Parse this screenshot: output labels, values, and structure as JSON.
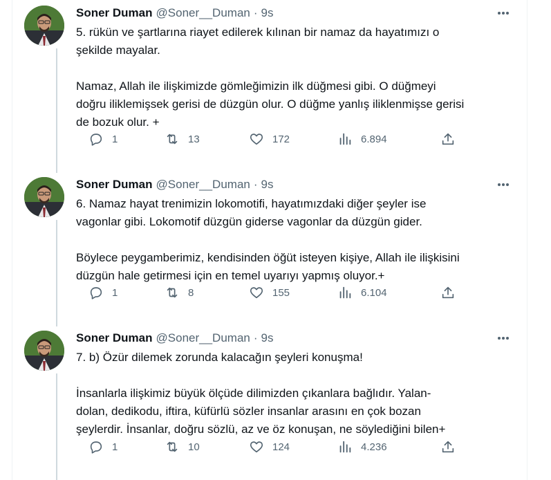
{
  "tweets": [
    {
      "name": "Soner Duman",
      "handle": "@Soner__Duman",
      "dot": "·",
      "time": "9s",
      "text": "5. rükün ve şartlarına riayet edilerek kılınan bir namaz da hayatımızı o\nşekilde mayalar.\n\nNamaz, Allah ile ilişkimizde gömleğimizin ilk düğmesi gibi. O düğmeyi\ndoğru iliklemişsek gerisi de düzgün olur. O düğme yanlış iliklenmişse gerisi\nde bozuk olur. +",
      "replies": "1",
      "retweets": "13",
      "likes": "172",
      "views": "6.894"
    },
    {
      "name": "Soner Duman",
      "handle": "@Soner__Duman",
      "dot": "·",
      "time": "9s",
      "text": "6. Namaz hayat trenimizin lokomotifi, hayatımızdaki diğer şeyler ise\nvagonlar gibi. Lokomotif düzgün giderse vagonlar da düzgün gider.\n\nBöylece peygamberimiz, kendisinden öğüt isteyen kişiye, Allah ile ilişkisini\ndüzgün hale getirmesi için en temel uyarıyı yapmış oluyor.+",
      "replies": "1",
      "retweets": "8",
      "likes": "155",
      "views": "6.104"
    },
    {
      "name": "Soner Duman",
      "handle": "@Soner__Duman",
      "dot": "·",
      "time": "9s",
      "text": "7. b) Özür dilemek zorunda kalacağın şeyleri konuşma!\n\nİnsanlarla ilişkimiz büyük ölçüde dilimizden çıkanlara bağlıdır. Yalan-\ndolan, dedikodu, iftira, küfürlü sözler insanlar arasını en çok bozan\nşeylerdir. İnsanlar, doğru sözlü, az ve öz konuşan, ne söylediğini bilen+",
      "replies": "1",
      "retweets": "10",
      "likes": "124",
      "views": "4.236"
    }
  ],
  "icons": {
    "reply": "reply-icon",
    "retweet": "retweet-icon",
    "like": "heart-icon",
    "views": "views-icon",
    "share": "share-icon",
    "more": "more-icon"
  },
  "colors": {
    "text": "#0f1419",
    "secondary": "#536471",
    "thread_line": "#cfd9de",
    "divider": "#eff3f4"
  }
}
